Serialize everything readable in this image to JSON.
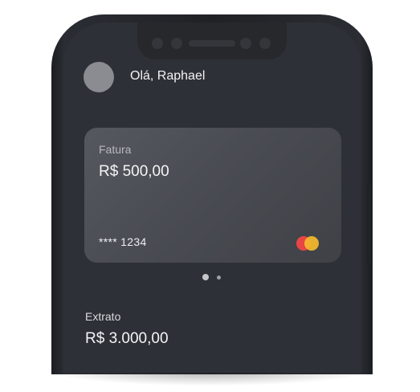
{
  "header": {
    "greeting": "Olá, Raphael"
  },
  "card": {
    "label": "Fatura",
    "amount": "R$ 500,00",
    "masked_number": "**** 1234",
    "brand_icon": "mastercard-icon"
  },
  "pager": {
    "active_index": 0,
    "count": 2
  },
  "statement": {
    "label": "Extrato",
    "amount": "R$ 3.000,00"
  },
  "colors": {
    "screen_background": "#2e3037",
    "card_background": "#4a4c53",
    "mastercard_red": "#e84545",
    "mastercard_yellow": "#f4ba2c"
  }
}
